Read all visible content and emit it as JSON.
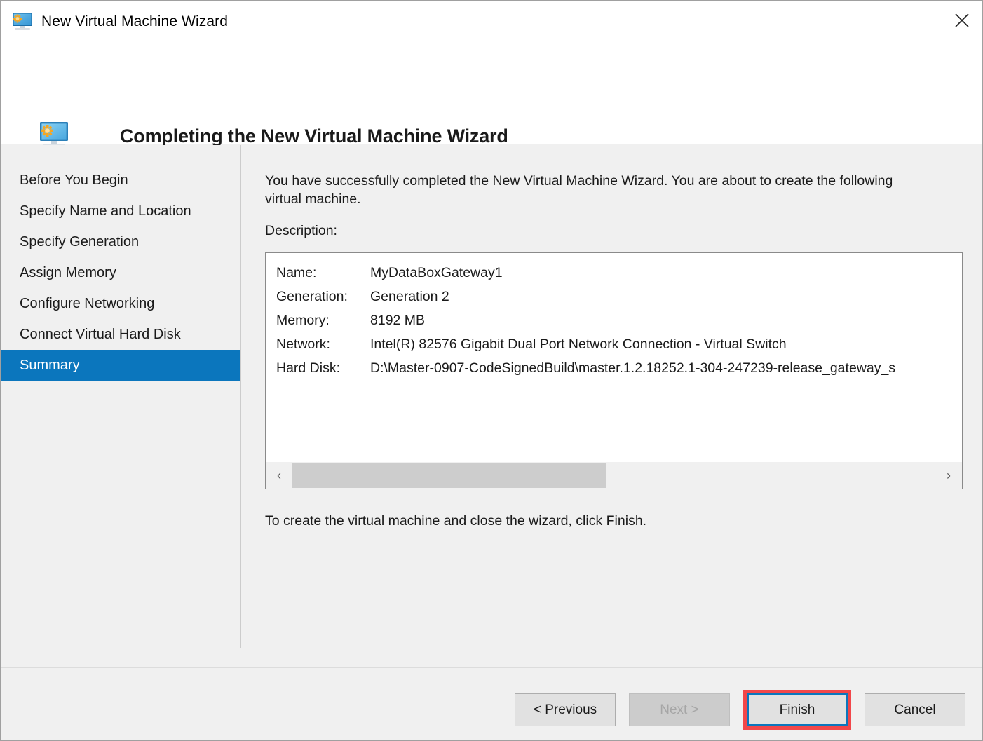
{
  "window": {
    "title": "New Virtual Machine Wizard",
    "icon": "virtual-machine-monitor-icon",
    "close_label": "✕"
  },
  "header": {
    "icon": "virtual-machine-monitor-icon",
    "title": "Completing the New Virtual Machine Wizard"
  },
  "sidebar": {
    "items": [
      {
        "label": "Before You Begin",
        "selected": false
      },
      {
        "label": "Specify Name and Location",
        "selected": false
      },
      {
        "label": "Specify Generation",
        "selected": false
      },
      {
        "label": "Assign Memory",
        "selected": false
      },
      {
        "label": "Configure Networking",
        "selected": false
      },
      {
        "label": "Connect Virtual Hard Disk",
        "selected": false
      },
      {
        "label": "Summary",
        "selected": true
      }
    ],
    "selected_color": "#0b76bd"
  },
  "content": {
    "intro": "You have successfully completed the New Virtual Machine Wizard. You are about to create the following virtual machine.",
    "description_label": "Description:",
    "summary_rows": [
      {
        "key": "Name:",
        "value": "MyDataBoxGateway1"
      },
      {
        "key": "Generation:",
        "value": "Generation 2"
      },
      {
        "key": "Memory:",
        "value": "8192 MB"
      },
      {
        "key": "Network:",
        "value": "Intel(R) 82576 Gigabit Dual Port Network Connection - Virtual Switch"
      },
      {
        "key": "Hard Disk:",
        "value": "D:\\Master-0907-CodeSignedBuild\\master.1.2.18252.1-304-247239-release_gateway_s"
      }
    ],
    "scrollbar": {
      "left_arrow": "‹",
      "right_arrow": "›",
      "thumb_position_percent": 0,
      "thumb_width_percent": 47
    },
    "finish_hint": "To create the virtual machine and close the wizard, click Finish."
  },
  "footer": {
    "buttons": [
      {
        "label": "< Previous",
        "state": "enabled",
        "name": "previous-button"
      },
      {
        "label": "Next >",
        "state": "disabled",
        "name": "next-button"
      },
      {
        "label": "Finish",
        "state": "focused",
        "name": "finish-button"
      },
      {
        "label": "Cancel",
        "state": "enabled",
        "name": "cancel-button"
      }
    ],
    "highlight_color": "#f2474a",
    "focus_color": "#0b76bd"
  }
}
